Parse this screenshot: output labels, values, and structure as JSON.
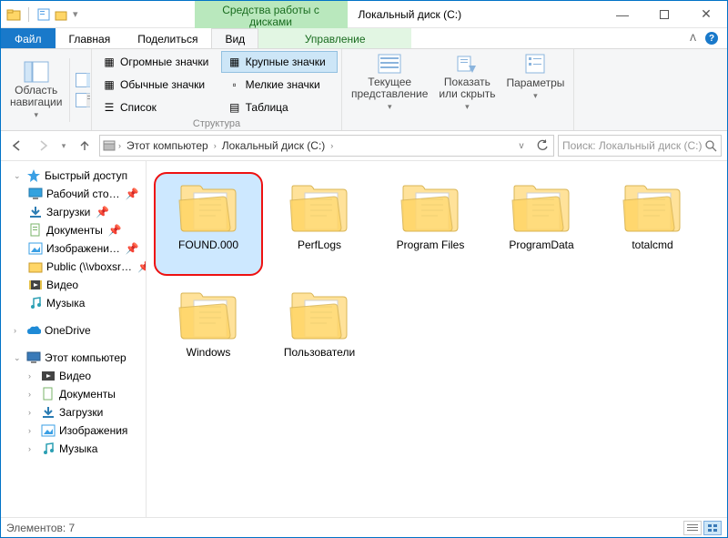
{
  "window": {
    "title": "Локальный диск (C:)",
    "contextual_tab": "Средства работы с дисками"
  },
  "tabs": {
    "file": "Файл",
    "home": "Главная",
    "share": "Поделиться",
    "view": "Вид",
    "manage": "Управление"
  },
  "ribbon": {
    "navpane_btn": "Область\nнавигации",
    "layouts": {
      "huge": "Огромные значки",
      "large": "Крупные значки",
      "medium": "Обычные значки",
      "small": "Мелкие значки",
      "list": "Список",
      "table": "Таблица"
    },
    "group_layout": "Структура",
    "current_view": "Текущее\nпредставление",
    "show_hide": "Показать\nили скрыть",
    "options": "Параметры"
  },
  "breadcrumbs": {
    "thispc": "Этот компьютер",
    "drive": "Локальный диск (C:)"
  },
  "search": {
    "placeholder": "Поиск: Локальный диск (C:)"
  },
  "tree": {
    "quick": "Быстрый доступ",
    "desktop": "Рабочий сто…",
    "downloads": "Загрузки",
    "documents": "Документы",
    "pictures": "Изображени…",
    "public": "Public (\\\\vboxsr…",
    "videos": "Видео",
    "music": "Музыка",
    "onedrive": "OneDrive",
    "thispc": "Этот компьютер",
    "pc_videos": "Видео",
    "pc_documents": "Документы",
    "pc_downloads": "Загрузки",
    "pc_pictures": "Изображения",
    "pc_music": "Музыка"
  },
  "items": [
    {
      "name": "FOUND.000",
      "highlighted": true,
      "selected": true
    },
    {
      "name": "PerfLogs"
    },
    {
      "name": "Program Files"
    },
    {
      "name": "ProgramData"
    },
    {
      "name": "totalcmd"
    },
    {
      "name": "Windows"
    },
    {
      "name": "Пользователи"
    }
  ],
  "status": {
    "text": "Элементов: 7"
  }
}
